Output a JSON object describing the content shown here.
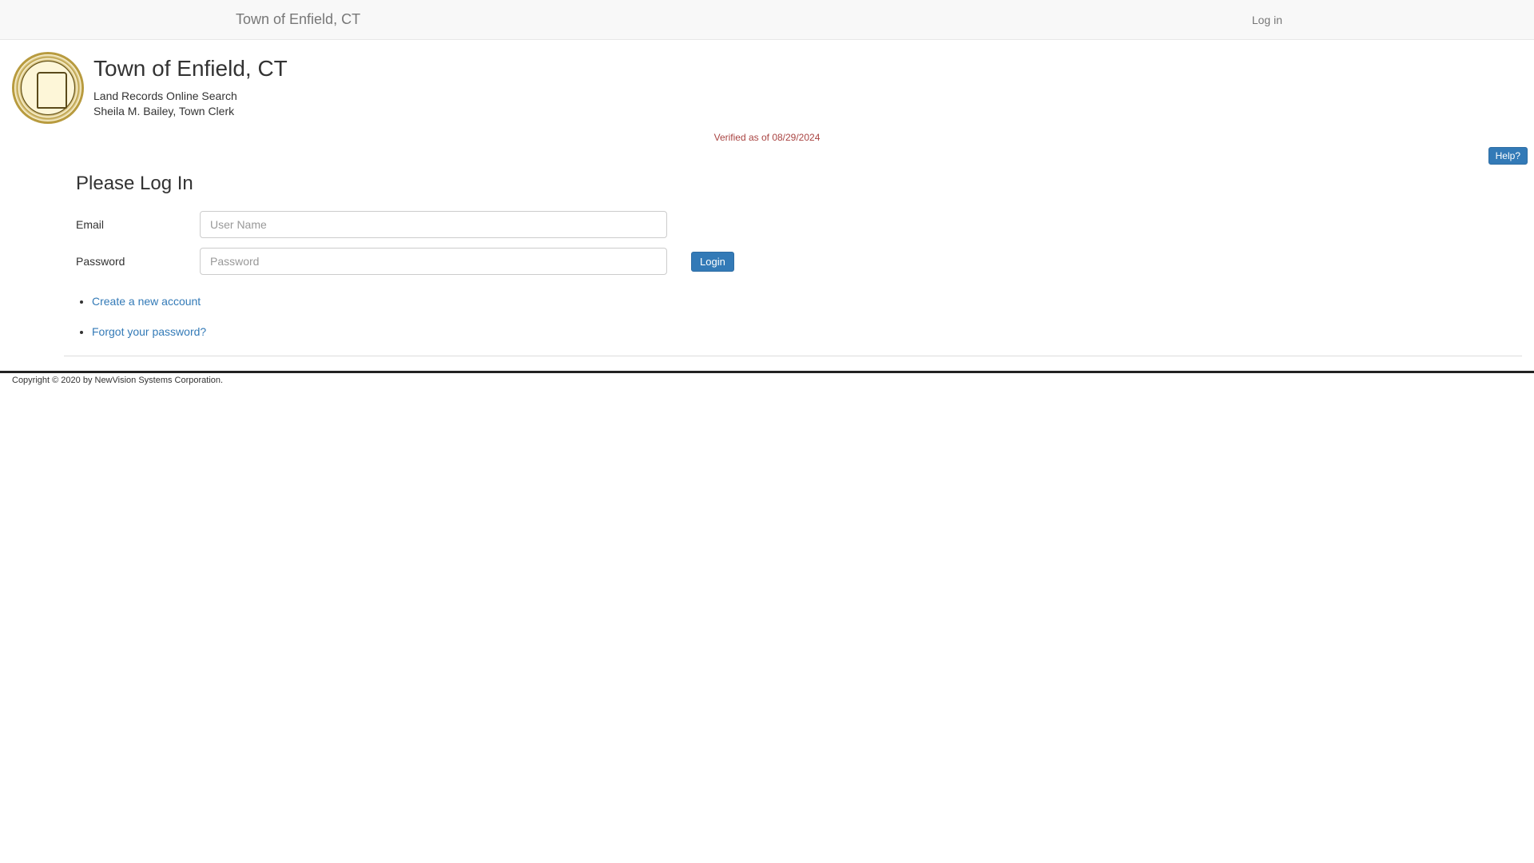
{
  "navbar": {
    "brand": "Town of Enfield, CT",
    "login_link": "Log in"
  },
  "header": {
    "title": "Town of Enfield, CT",
    "subtitle1": "Land Records Online Search",
    "subtitle2": "Sheila M. Bailey, Town Clerk"
  },
  "verified_text": "Verified as of 08/29/2024",
  "help_button": "Help?",
  "login": {
    "heading": "Please Log In",
    "email_label": "Email",
    "email_placeholder": "User Name",
    "password_label": "Password",
    "password_placeholder": "Password",
    "login_button": "Login"
  },
  "links": {
    "create_account": "Create a new account",
    "forgot_password": "Forgot your password?"
  },
  "footer": {
    "copyright": "Copyright © 2020 by NewVision Systems Corporation."
  }
}
